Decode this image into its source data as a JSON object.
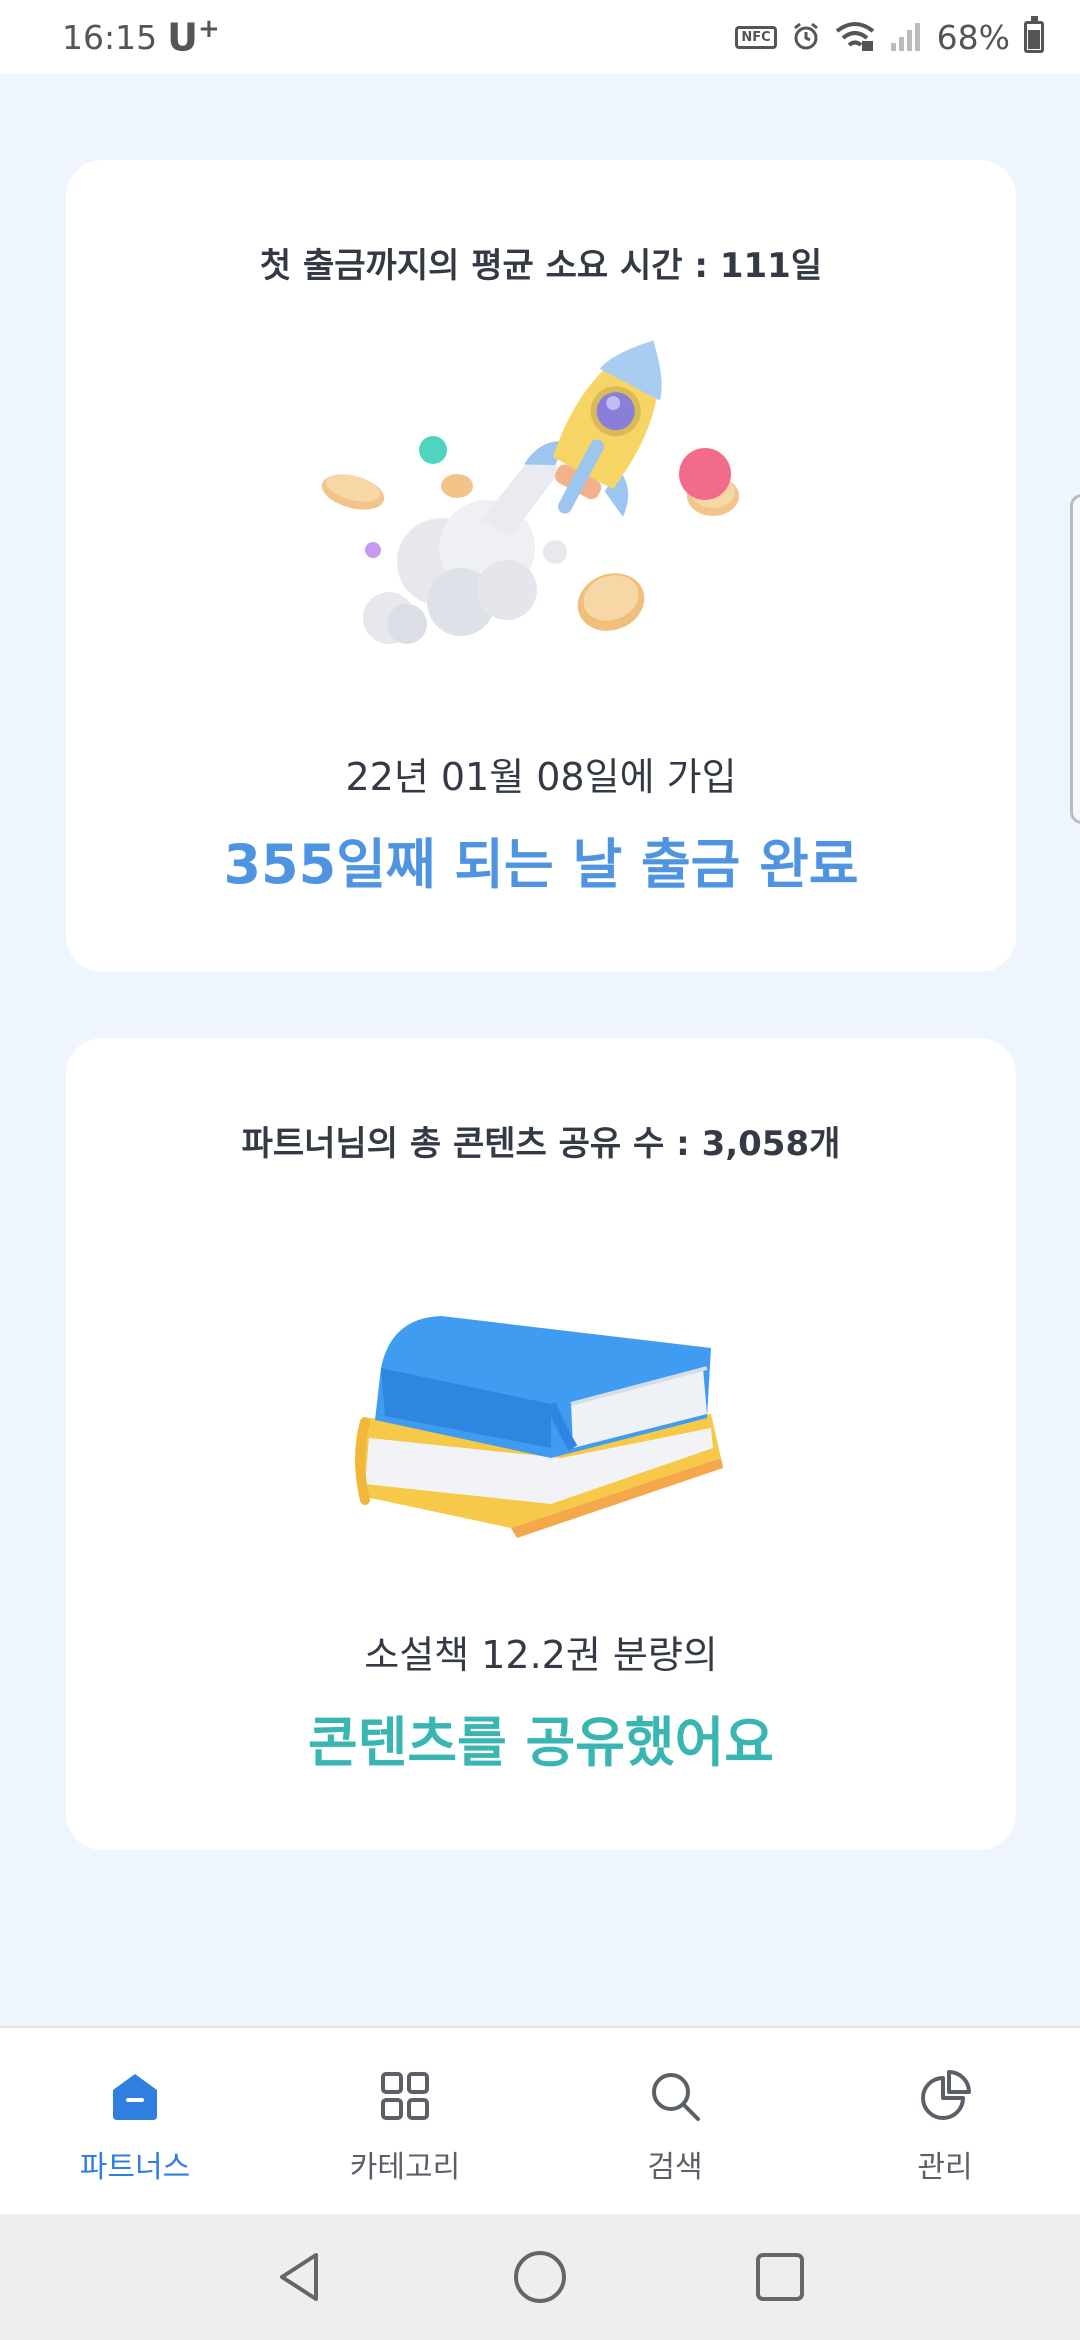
{
  "status_bar": {
    "time": "16:15",
    "carrier": "U",
    "carrier_sup": "+",
    "nfc": "NFC",
    "battery": "68%"
  },
  "card_payout": {
    "title": "첫 출금까지의 평균 소요 시간 : 111일",
    "joined_text": "22년 01월 08일에 가입",
    "highlight": "355일째 되는 날 출금 완료",
    "highlight_color": "#4e94e0",
    "illustration": "rocket-with-coins"
  },
  "card_shares": {
    "title": "파트너님의 총 콘텐츠 공유 수 : 3,058개",
    "sub_text": "소설책 12.2권 분량의",
    "highlight": "콘텐츠를 공유했어요",
    "highlight_color": "#39b6b2",
    "illustration": "stacked-books"
  },
  "tab_bar": {
    "tabs": [
      {
        "label": "파트너스",
        "icon": "home-icon",
        "active": true
      },
      {
        "label": "카테고리",
        "icon": "grid-icon",
        "active": false
      },
      {
        "label": "검색",
        "icon": "search-icon",
        "active": false
      },
      {
        "label": "관리",
        "icon": "pie-chart-icon",
        "active": false
      }
    ],
    "active_color": "#2f7fe0"
  },
  "nav_bar": {
    "buttons": [
      "back-icon",
      "home-circle-icon",
      "recents-icon"
    ]
  }
}
